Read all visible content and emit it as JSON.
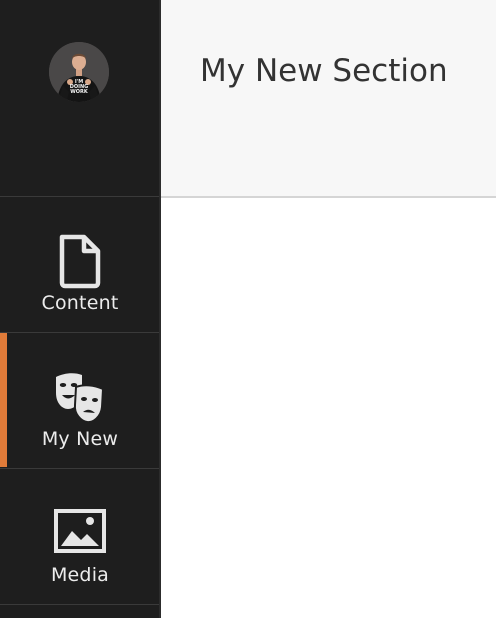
{
  "header": {
    "title": "My New Section"
  },
  "sidebar": {
    "items": [
      {
        "label": "Content",
        "icon": "document-icon",
        "active": false
      },
      {
        "label": "My New",
        "icon": "theater-masks-icon",
        "active": true
      },
      {
        "label": "Media",
        "icon": "image-icon",
        "active": false
      }
    ]
  },
  "colors": {
    "sidebar_bg": "#1e1e1e",
    "active_accent": "#e07b39",
    "header_bg": "#f7f7f7"
  },
  "avatar": {
    "shirt_text": "I'M DOING WORK"
  }
}
